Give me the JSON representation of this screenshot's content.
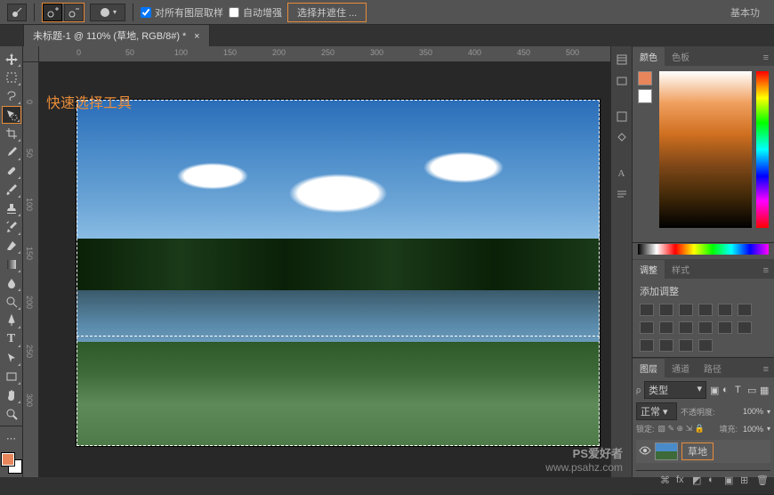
{
  "optbar": {
    "sample_all_layers": "对所有图层取样",
    "auto_enhance": "自动增强",
    "select_mask": "选择并遮住 ...",
    "workspace": "基本功"
  },
  "doc": {
    "title": "未标题-1 @ 110% (草地, RGB/8#) *"
  },
  "annotation": "快速选择工具",
  "ruler_h": [
    "0",
    "50",
    "100",
    "150",
    "200",
    "250",
    "300",
    "350",
    "400",
    "450",
    "500"
  ],
  "ruler_v": [
    "0",
    "50",
    "100",
    "150",
    "200",
    "250",
    "300"
  ],
  "panels": {
    "color": {
      "tab1": "颜色",
      "tab2": "色板"
    },
    "adjustments": {
      "tab1": "调整",
      "tab2": "样式",
      "title": "添加调整"
    },
    "layers": {
      "tab1": "图层",
      "tab2": "通道",
      "tab3": "路径",
      "kind": "类型",
      "blend": "正常",
      "opacity_label": "不透明度:",
      "opacity_value": "100%",
      "lock_label": "锁定:",
      "fill_label": "填充:",
      "fill_value": "100%",
      "layer_name": "草地"
    }
  },
  "watermark1": "PS爱好者",
  "watermark2": "www.psahz.com"
}
